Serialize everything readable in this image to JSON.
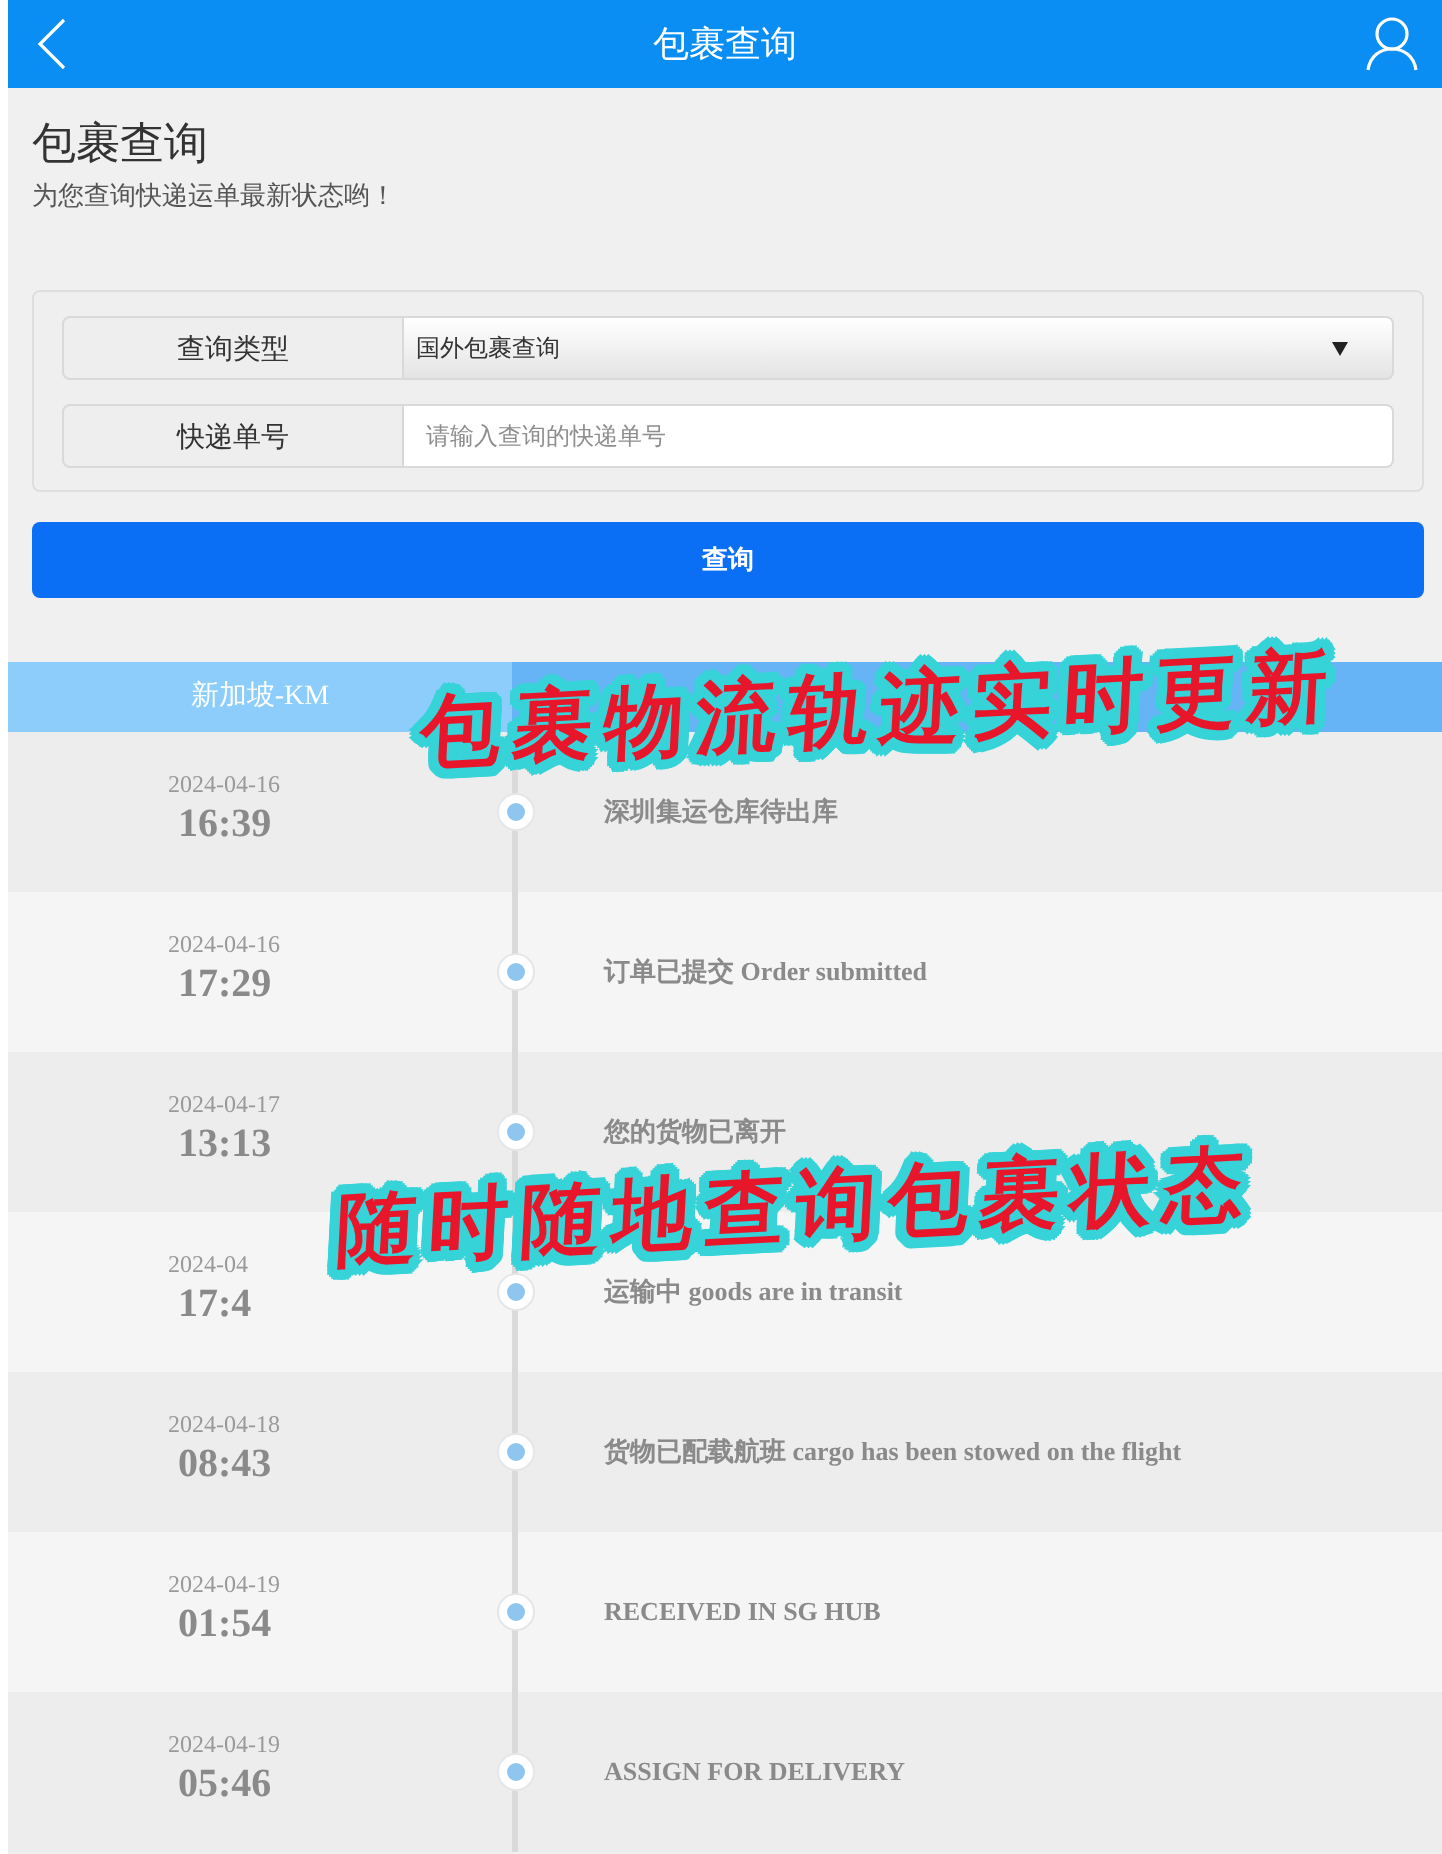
{
  "header": {
    "title": "包裹查询"
  },
  "intro": {
    "heading": "包裹查询",
    "subtitle": "为您查询快递运单最新状态哟！"
  },
  "form": {
    "fields": [
      {
        "kind": "select",
        "label": "查询类型",
        "value": "国外包裹查询"
      },
      {
        "kind": "input",
        "label": "快递单号",
        "placeholder": "请输入查询的快递单号"
      }
    ],
    "submit": "查询"
  },
  "tracking": {
    "column_1": "新加坡-KM",
    "events": [
      {
        "date": "2024-04-16",
        "time": "16:39",
        "text": "深圳集运仓库待出库"
      },
      {
        "date": "2024-04-16",
        "time": "17:29",
        "text": "订单已提交 Order submitted"
      },
      {
        "date": "2024-04-17",
        "time": "13:13",
        "text": "您的货物已离开"
      },
      {
        "date": "2024-04",
        "time": "17:4",
        "text": "运输中 goods are in transit"
      },
      {
        "date": "2024-04-18",
        "time": "08:43",
        "text": "货物已配载航班 cargo has been stowed on the flight"
      },
      {
        "date": "2024-04-19",
        "time": "01:54",
        "text": "RECEIVED IN SG HUB"
      },
      {
        "date": "2024-04-19",
        "time": "05:46",
        "text": "ASSIGN FOR DELIVERY"
      }
    ]
  },
  "overlays": [
    {
      "text": "包裹物流轨迹实时更新"
    },
    {
      "text": "随时随地查询包裹状态"
    }
  ]
}
